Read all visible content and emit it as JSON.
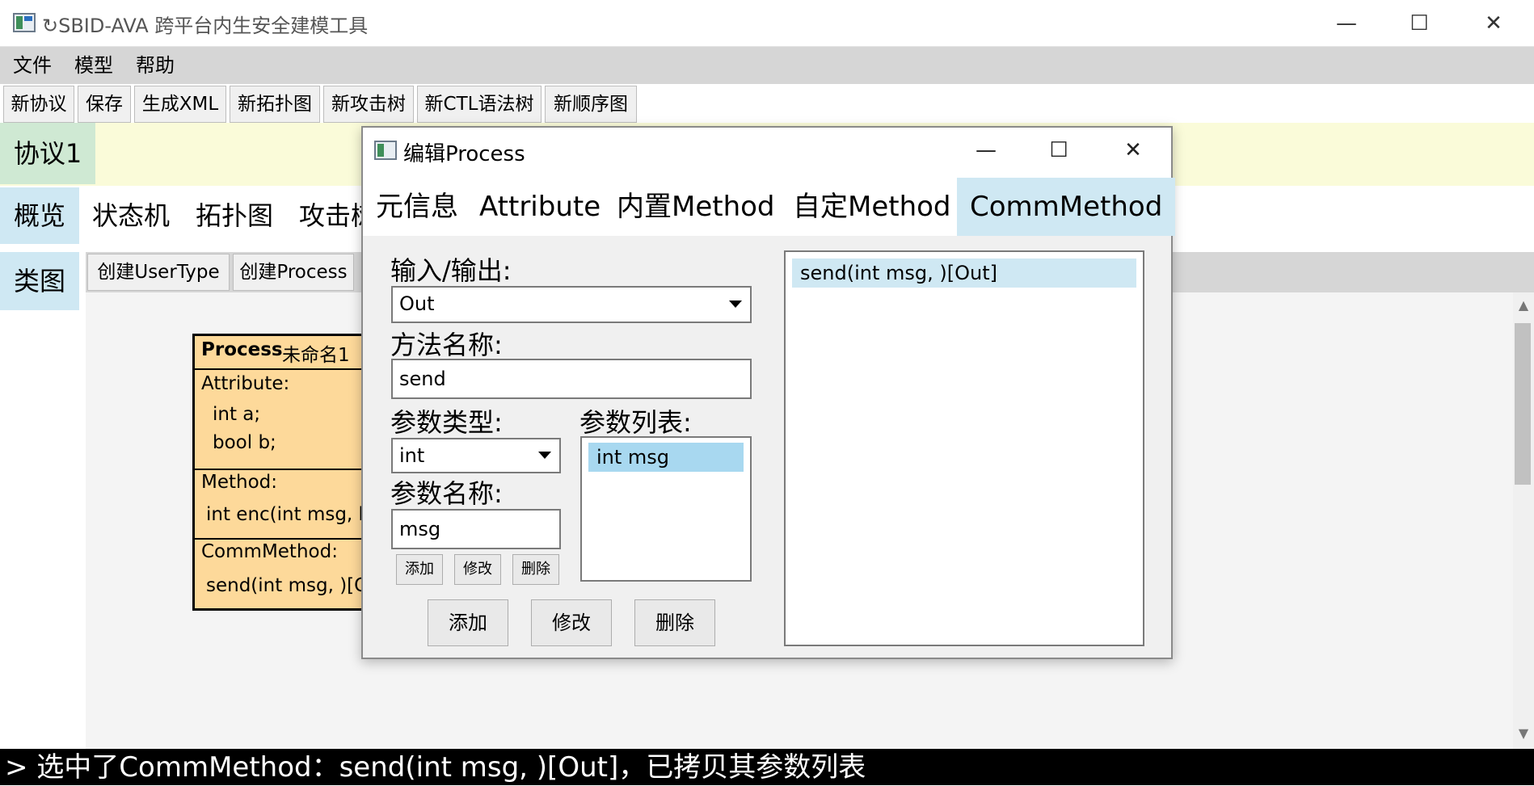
{
  "window": {
    "title": "↻SBID-AVA 跨平台内生安全建模工具",
    "minimize": "—",
    "maximize": "☐",
    "close": "✕"
  },
  "menu": [
    "文件",
    "模型",
    "帮助"
  ],
  "toolbar": [
    "新协议",
    "保存",
    "生成XML",
    "新拓扑图",
    "新攻击树",
    "新CTL语法树",
    "新顺序图"
  ],
  "protocol_tab": "协议1",
  "view_tabs": [
    "概览",
    "状态机",
    "拓扑图",
    "攻击树"
  ],
  "class_tab": "类图",
  "canvas_toolbar": [
    "创建UserType",
    "创建Process"
  ],
  "process_box": {
    "kind": "Process",
    "name": "未命名1",
    "attr_header": "Attribute:",
    "attrs": [
      "int a;",
      "bool b;"
    ],
    "method_header": "Method:",
    "methods": [
      "int enc(int msg, b"
    ],
    "comm_header": "CommMethod:",
    "comms": [
      "send(int msg, )[O"
    ]
  },
  "dialog": {
    "title": "编辑Process",
    "tabs": [
      "元信息",
      "Attribute",
      "内置Method",
      "自定Method",
      "CommMethod"
    ],
    "active_tab": "CommMethod",
    "io_label": "输入/输出:",
    "io_value": "Out",
    "method_name_label": "方法名称:",
    "method_name_value": "send",
    "param_type_label": "参数类型:",
    "param_type_value": "int",
    "param_list_label": "参数列表:",
    "param_list": [
      "int msg"
    ],
    "param_name_label": "参数名称:",
    "param_name_value": "msg",
    "small_buttons": [
      "添加",
      "修改",
      "删除"
    ],
    "big_buttons": [
      "添加",
      "修改",
      "删除"
    ],
    "comm_methods": [
      "send(int msg, )[Out]"
    ]
  },
  "status": "> 选中了CommMethod：send(int msg, )[Out]，已拷贝其参数列表",
  "colors": {
    "selected": "#cfe8f3",
    "selected_list": "#a8d8f0",
    "process_fill": "#fdd99a",
    "protocol_bar": "#fafbd9",
    "protocol_tab": "#cfe9d3"
  }
}
